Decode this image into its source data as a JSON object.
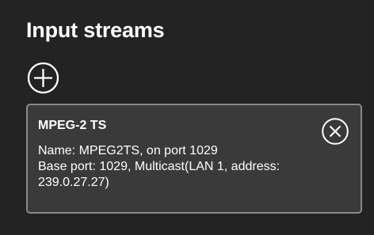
{
  "panel": {
    "title": "Input streams"
  },
  "icons": {
    "add": "plus-circle-icon",
    "remove": "x-circle-icon"
  },
  "streams": [
    {
      "type": "MPEG-2 TS",
      "name_line": "Name: MPEG2TS, on port 1029",
      "base_line_1": "Base port: 1029, Multicast(LAN 1, address:",
      "base_line_2": "239.0.27.27)"
    }
  ],
  "colors": {
    "background": "#232323",
    "card_background": "#3a3a3a",
    "card_border": "#8a8a8a",
    "text": "#ffffff"
  }
}
